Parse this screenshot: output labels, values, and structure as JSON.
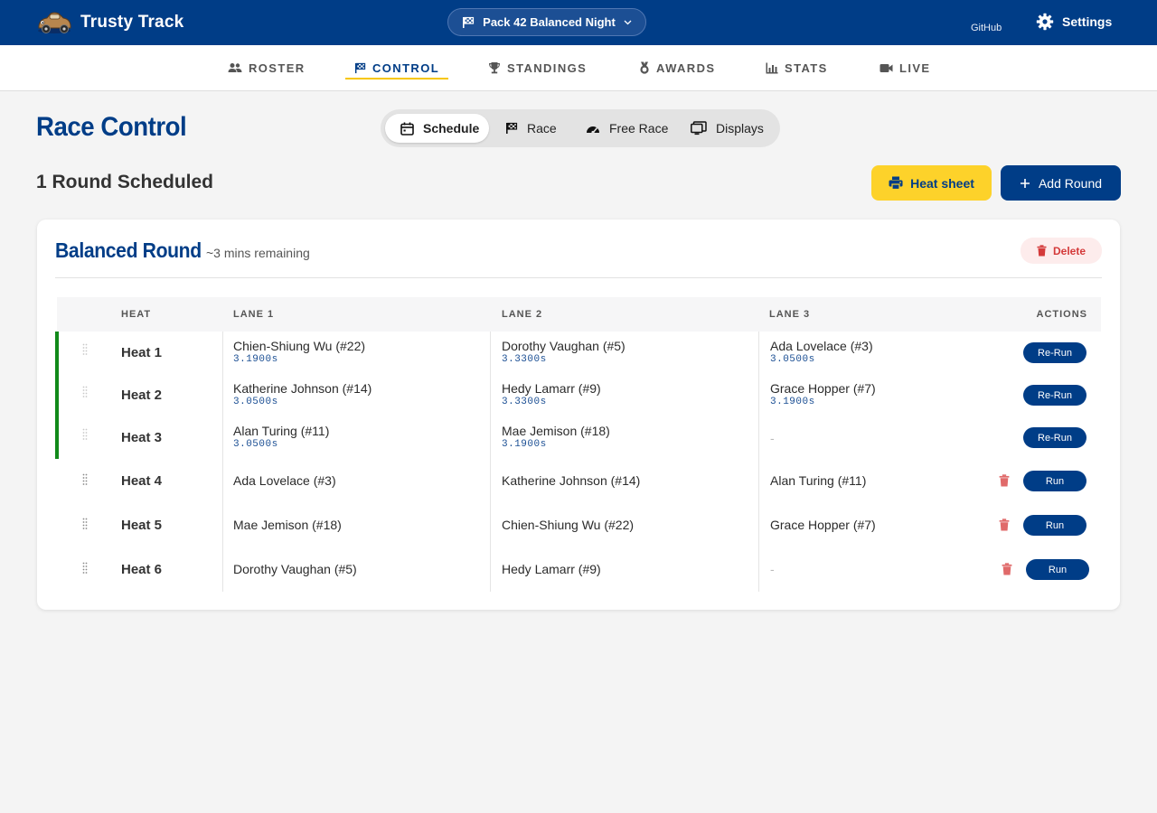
{
  "app": {
    "name": "Trusty Track",
    "event_name": "Pack 42 Balanced Night",
    "github_label": "GitHub",
    "settings_label": "Settings"
  },
  "nav": {
    "tabs": [
      {
        "label": "ROSTER",
        "icon": "people-icon"
      },
      {
        "label": "CONTROL",
        "icon": "checkered-flag-icon",
        "active": true
      },
      {
        "label": "STANDINGS",
        "icon": "trophy-icon"
      },
      {
        "label": "AWARDS",
        "icon": "medal-icon"
      },
      {
        "label": "STATS",
        "icon": "bar-chart-icon"
      },
      {
        "label": "LIVE",
        "icon": "video-camera-icon"
      }
    ]
  },
  "page": {
    "title": "Race Control",
    "modes": [
      {
        "label": "Schedule",
        "icon": "calendar-icon",
        "active": true
      },
      {
        "label": "Race",
        "icon": "checkered-flag-icon"
      },
      {
        "label": "Free Race",
        "icon": "speedometer-icon"
      },
      {
        "label": "Displays",
        "icon": "monitor-icon"
      }
    ],
    "subtitle": "1 Round Scheduled",
    "heat_sheet_label": "Heat sheet",
    "add_round_label": "Add Round"
  },
  "round": {
    "name": "Balanced Round",
    "remaining": "~3 mins remaining",
    "delete_label": "Delete",
    "columns": {
      "heat": "HEAT",
      "lane1": "LANE 1",
      "lane2": "LANE 2",
      "lane3": "LANE 3",
      "actions": "ACTIONS"
    },
    "heats": [
      {
        "label": "Heat 1",
        "completed": true,
        "action": "Re-Run",
        "lanes": [
          {
            "racer": "Chien-Shiung Wu (#22)",
            "time": "3.1900s"
          },
          {
            "racer": "Dorothy Vaughan (#5)",
            "time": "3.3300s"
          },
          {
            "racer": "Ada Lovelace (#3)",
            "time": "3.0500s"
          }
        ]
      },
      {
        "label": "Heat 2",
        "completed": true,
        "action": "Re-Run",
        "lanes": [
          {
            "racer": "Katherine Johnson (#14)",
            "time": "3.0500s"
          },
          {
            "racer": "Hedy Lamarr (#9)",
            "time": "3.3300s"
          },
          {
            "racer": "Grace Hopper (#7)",
            "time": "3.1900s"
          }
        ]
      },
      {
        "label": "Heat 3",
        "completed": true,
        "action": "Re-Run",
        "lanes": [
          {
            "racer": "Alan Turing (#11)",
            "time": "3.0500s"
          },
          {
            "racer": "Mae Jemison (#18)",
            "time": "3.1900s"
          },
          {
            "racer": "-",
            "time": ""
          }
        ]
      },
      {
        "label": "Heat 4",
        "completed": false,
        "action": "Run",
        "lanes": [
          {
            "racer": "Ada Lovelace (#3)",
            "time": ""
          },
          {
            "racer": "Katherine Johnson (#14)",
            "time": ""
          },
          {
            "racer": "Alan Turing (#11)",
            "time": ""
          }
        ]
      },
      {
        "label": "Heat 5",
        "completed": false,
        "action": "Run",
        "lanes": [
          {
            "racer": "Mae Jemison (#18)",
            "time": ""
          },
          {
            "racer": "Chien-Shiung Wu (#22)",
            "time": ""
          },
          {
            "racer": "Grace Hopper (#7)",
            "time": ""
          }
        ]
      },
      {
        "label": "Heat 6",
        "completed": false,
        "action": "Run",
        "lanes": [
          {
            "racer": "Dorothy Vaughan (#5)",
            "time": ""
          },
          {
            "racer": "Hedy Lamarr (#9)",
            "time": ""
          },
          {
            "racer": "-",
            "time": ""
          }
        ]
      }
    ]
  },
  "colors": {
    "brand": "#003d87",
    "accent": "#fdd22a",
    "completed": "#118a1a",
    "danger": "#d43a3a"
  }
}
